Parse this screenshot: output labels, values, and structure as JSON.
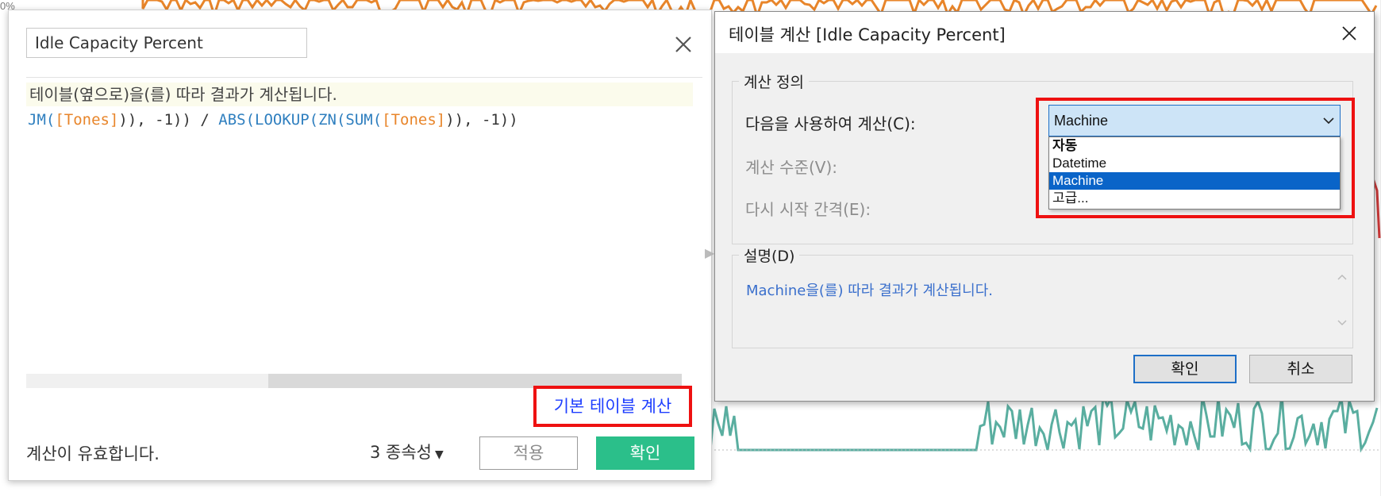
{
  "background": {
    "top_label": "0%",
    "colors": {
      "orange": "#e8852a",
      "teal": "#5aaea0",
      "red": "#d23a3a"
    }
  },
  "calc_editor": {
    "name_value": "Idle Capacity Percent",
    "hint": "테이블(옆으로)을(를) 따라 결과가 계산됩니다.",
    "formula": {
      "p1": "JM(",
      "p2": "[Tones]",
      "p3": ")), -1)) / ",
      "p4": "ABS(LOOKUP(ZN(SUM(",
      "p5": "[Tones]",
      "p6": ")), -1))"
    },
    "default_table_calc_link": "기본 테이블 계산",
    "valid_message": "계산이 유효합니다.",
    "dependencies_label": "3 종속성",
    "apply_label": "적용",
    "ok_label": "확인",
    "accent_color": "#2bbf8a",
    "highlight_color": "#ee1111"
  },
  "table_calc_dialog": {
    "title": "테이블 계산 [Idle Capacity Percent]",
    "definition_group": "계산 정의",
    "compute_using_label": "다음을 사용하여 계산(C):",
    "compute_using_value": "Machine",
    "dropdown_options": [
      "자동",
      "Datetime",
      "Machine",
      "고급..."
    ],
    "selected_option": "Machine",
    "level_label": "계산 수준(V):",
    "restart_label": "다시 시작 간격(E):",
    "description_group": "설명(D)",
    "description_text": "Machine을(를) 따라 결과가 계산됩니다.",
    "ok_label": "확인",
    "cancel_label": "취소",
    "select_color": "#cde4f7",
    "selected_item_color": "#0a64c8"
  }
}
